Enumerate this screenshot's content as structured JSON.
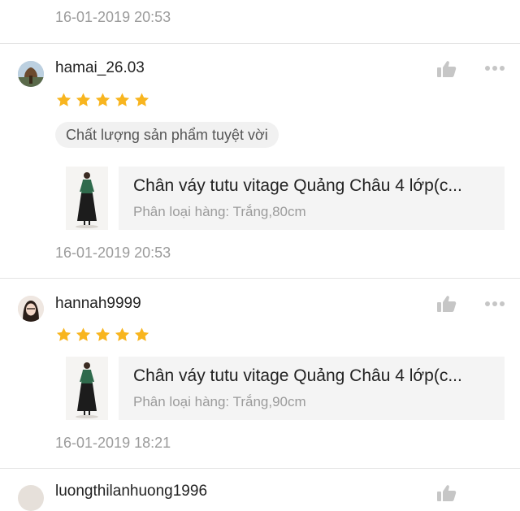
{
  "reviews": [
    {
      "timestamp": "16-01-2019 20:53"
    },
    {
      "username": "hamai_26.03",
      "rating": 5,
      "tag": "Chất lượng sản phẩm tuyệt vời",
      "product": {
        "name": "Chân váy tutu vitage Quảng Châu 4 lớp(c...",
        "variant": "Phân loại hàng: Trắng,80cm"
      },
      "timestamp": "16-01-2019 20:53",
      "like_icon": "thumbs-up-icon",
      "more_icon": "more-dots-icon"
    },
    {
      "username": "hannah9999",
      "rating": 5,
      "product": {
        "name": "Chân váy tutu vitage Quảng Châu 4 lớp(c...",
        "variant": "Phân loại hàng: Trắng,90cm"
      },
      "timestamp": "16-01-2019 18:21",
      "like_icon": "thumbs-up-icon",
      "more_icon": "more-dots-icon"
    },
    {
      "username": "luongthilanhuong1996"
    }
  ],
  "colors": {
    "star": "#f8b51f",
    "icon": "#c6c6c6",
    "timestamp": "#9b9b9b",
    "divider": "#e4e4e4",
    "tag_bg": "#f1f1f1",
    "product_bg": "#f4f4f4"
  }
}
